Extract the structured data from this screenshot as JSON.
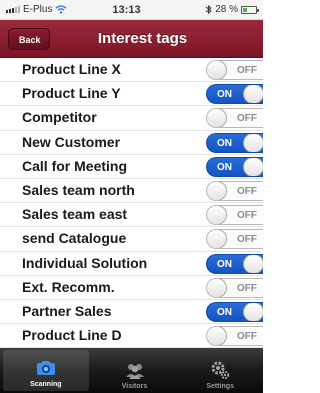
{
  "status_bar": {
    "carrier": "E-Plus",
    "time": "13:13",
    "battery": "28 %"
  },
  "nav": {
    "back_label": "Back",
    "title": "Interest tags"
  },
  "toggle_labels": {
    "on": "ON",
    "off": "OFF"
  },
  "tags": [
    {
      "label": "Product Line X",
      "state": "OFF"
    },
    {
      "label": "Product Line Y",
      "state": "ON"
    },
    {
      "label": "Competitor",
      "state": "OFF"
    },
    {
      "label": "New Customer",
      "state": "ON"
    },
    {
      "label": "Call for Meeting",
      "state": "ON"
    },
    {
      "label": "Sales team north",
      "state": "OFF"
    },
    {
      "label": "Sales team east",
      "state": "OFF"
    },
    {
      "label": "send Catalogue",
      "state": "OFF"
    },
    {
      "label": "Individual Solution",
      "state": "ON"
    },
    {
      "label": "Ext. Recomm.",
      "state": "OFF"
    },
    {
      "label": "Partner Sales",
      "state": "ON"
    },
    {
      "label": "Product Line D",
      "state": "OFF"
    }
  ],
  "tabs": [
    {
      "label": "Scanning",
      "icon": "camera-icon",
      "active": true
    },
    {
      "label": "Visitors",
      "icon": "people-icon",
      "active": false
    },
    {
      "label": "Settings",
      "icon": "gears-icon",
      "active": false
    }
  ],
  "colors": {
    "nav_bar": "#8b1c30",
    "toggle_on": "#1f5fd0",
    "tab_bar": "#1a1a1a"
  }
}
